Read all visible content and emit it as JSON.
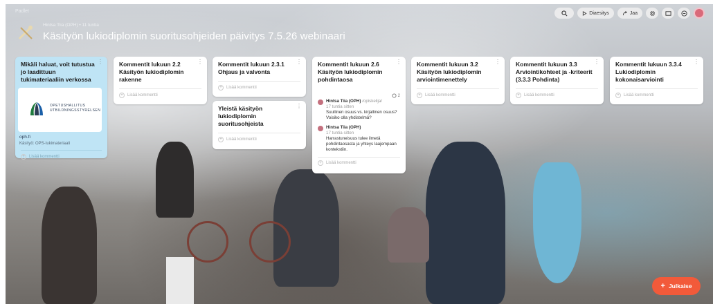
{
  "app": {
    "name": "Padlet"
  },
  "header": {
    "breadcrumb": "Hintsa Tiia (OPH) • 11 tuntia",
    "title": "Käsityön lukiodiplomin suoritusohjeiden päivitys 7.5.26 webinaari"
  },
  "toolbar": {
    "search_icon": "search-icon",
    "slideshow_label": "Diaesitys",
    "share_label": "Jaa"
  },
  "add_comment_label": "Lisää kommentti",
  "cards": {
    "intro": {
      "title": "Mikäli haluat, voit tutustua jo laadittuun tukimateriaaliin verkossa",
      "link_org_line1": "OPETUSHALLITUS",
      "link_org_line2": "UTBILDNINGSSTYRELSEN",
      "link_domain": "oph.fi",
      "link_desc": "Käsityö: OPS-tukimateriaali"
    },
    "c22": {
      "title": "Kommentit lukuun 2.2 Käsityön lukiodiplomin rakenne"
    },
    "c231": {
      "title": "Kommentit lukuun 2.3.1 Ohjaus ja valvonta"
    },
    "general": {
      "title": "Yleistä käsityön lukiodiplomin suoritusohjeista"
    },
    "c26": {
      "title": "Kommentit lukuun 2.6 Käsityön lukiodiplomin pohdintaosa",
      "comment_count": "2",
      "comments": [
        {
          "name": "Hintsa Tiia (OPH)",
          "role": "/opiskelija/",
          "time": "17 tuntia sitten",
          "text": "Suullinen osuus vs. kirjallinen osuus? Voisiko olla yhdistelmä?"
        },
        {
          "name": "Hintsa Tiia (OPH)",
          "role": "",
          "time": "17 tuntia sitten",
          "text": "Harrastuneisuus tulee ilmetä pohdintaosasta ja yhteys laajempaan kontekstiin."
        }
      ]
    },
    "c32": {
      "title": "Kommentit lukuun 3.2 Käsityön lukiodiplomin arviointimenettely"
    },
    "c33": {
      "title": "Kommentit lukuun 3.3 Arviointikohteet ja -kriteerit (3.3.3 Pohdinta)"
    },
    "c334": {
      "title": "Kommentit lukuun 3.3.4 Lukiodiplomin kokonaisarviointi"
    }
  },
  "publish": {
    "label": "Julkaise"
  },
  "colors": {
    "accent": "#f25a3a",
    "intro_card": "#bfe4f5"
  }
}
